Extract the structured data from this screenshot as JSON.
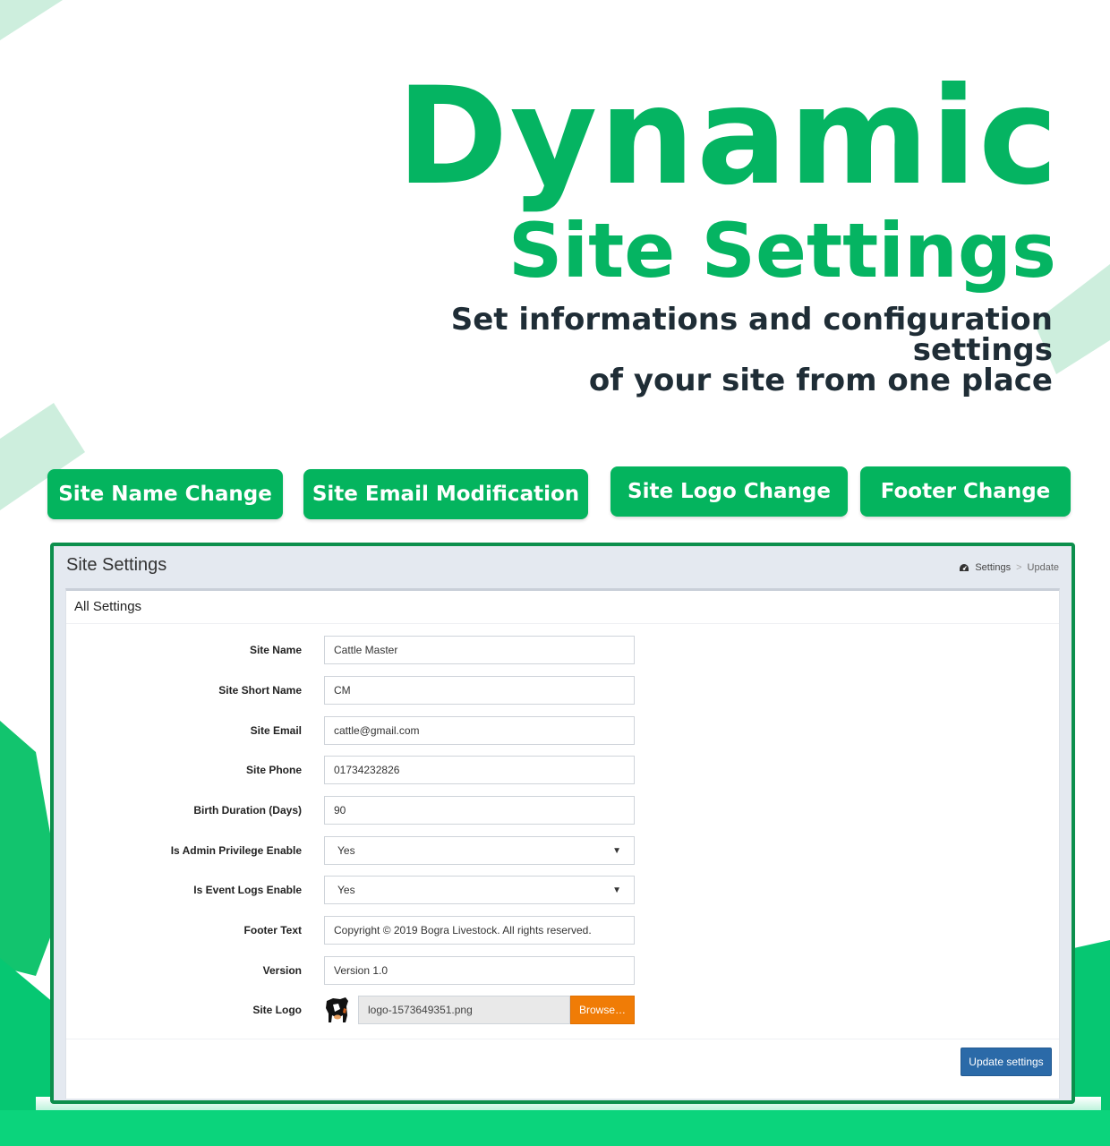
{
  "hero": {
    "title": "Dynamic",
    "subtitle": "Site Settings",
    "description_line1": "Set informations and configuration settings",
    "description_line2": "of your site from one place"
  },
  "features": [
    {
      "label": "Site Name Change"
    },
    {
      "label": "Site Email Modification"
    },
    {
      "label": "Site Logo Change"
    },
    {
      "label": "Footer Change"
    }
  ],
  "app": {
    "page_title": "Site Settings",
    "breadcrumb": {
      "icon": "dashboard-icon",
      "items": [
        "Settings",
        "Update"
      ],
      "separator": ">"
    },
    "box_title": "All Settings",
    "fields": [
      {
        "label": "Site Name",
        "value": "Cattle Master"
      },
      {
        "label": "Site Short Name",
        "value": "CM"
      },
      {
        "label": "Site Email",
        "value": "cattle@gmail.com"
      },
      {
        "label": "Site Phone",
        "value": "01734232826"
      },
      {
        "label": "Birth Duration (Days)",
        "value": "90"
      },
      {
        "label": "Is Admin Privilege Enable",
        "value": "Yes"
      },
      {
        "label": "Is Event Logs Enable",
        "value": "Yes"
      },
      {
        "label": "Footer Text",
        "value": "Copyright © 2019 Bogra Livestock. All rights reserved."
      },
      {
        "label": "Version",
        "value": "Version 1.0"
      },
      {
        "label": "Site Logo",
        "file_name": "logo-1573649351.png",
        "browse_label": "Browse…"
      }
    ],
    "submit_label": "Update settings"
  },
  "colors": {
    "brand_green": "#05b462",
    "button_green": "#04b45e",
    "panel_border": "#0c8f4c",
    "browse_orange": "#f07c06",
    "update_blue": "#2b6aa8",
    "heading_dark": "#1f2d36"
  }
}
